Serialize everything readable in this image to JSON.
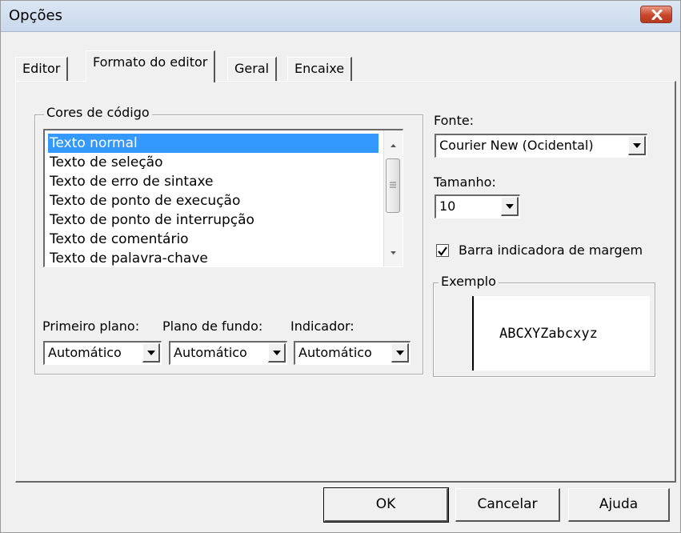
{
  "window": {
    "title": "Opções"
  },
  "tabs": [
    {
      "label": "Editor",
      "active": false
    },
    {
      "label": "Formato do editor",
      "active": true
    },
    {
      "label": "Geral",
      "active": false
    },
    {
      "label": "Encaixe",
      "active": false
    }
  ],
  "code_colors": {
    "group_label": "Cores de código",
    "items": [
      "Texto normal",
      "Texto de seleção",
      "Texto de erro de sintaxe",
      "Texto de ponto de execução",
      "Texto de ponto de interrupção",
      "Texto de comentário",
      "Texto de palavra-chave"
    ],
    "selected_index": 0,
    "foreground_label": "Primeiro plano:",
    "foreground_value": "Automático",
    "background_label": "Plano de fundo:",
    "background_value": "Automático",
    "indicator_label": "Indicador:",
    "indicator_value": "Automático"
  },
  "font": {
    "label": "Fonte:",
    "value": "Courier New (Ocidental)"
  },
  "size": {
    "label": "Tamanho:",
    "value": "10"
  },
  "margin_bar": {
    "label": "Barra indicadora de margem",
    "checked": true
  },
  "example": {
    "label": "Exemplo",
    "text": "ABCXYZabcxyz"
  },
  "buttons": {
    "ok": "OK",
    "cancel": "Cancelar",
    "help": "Ajuda"
  },
  "colors": {
    "selection": "#3399ff",
    "close_button": "#c8462a"
  }
}
